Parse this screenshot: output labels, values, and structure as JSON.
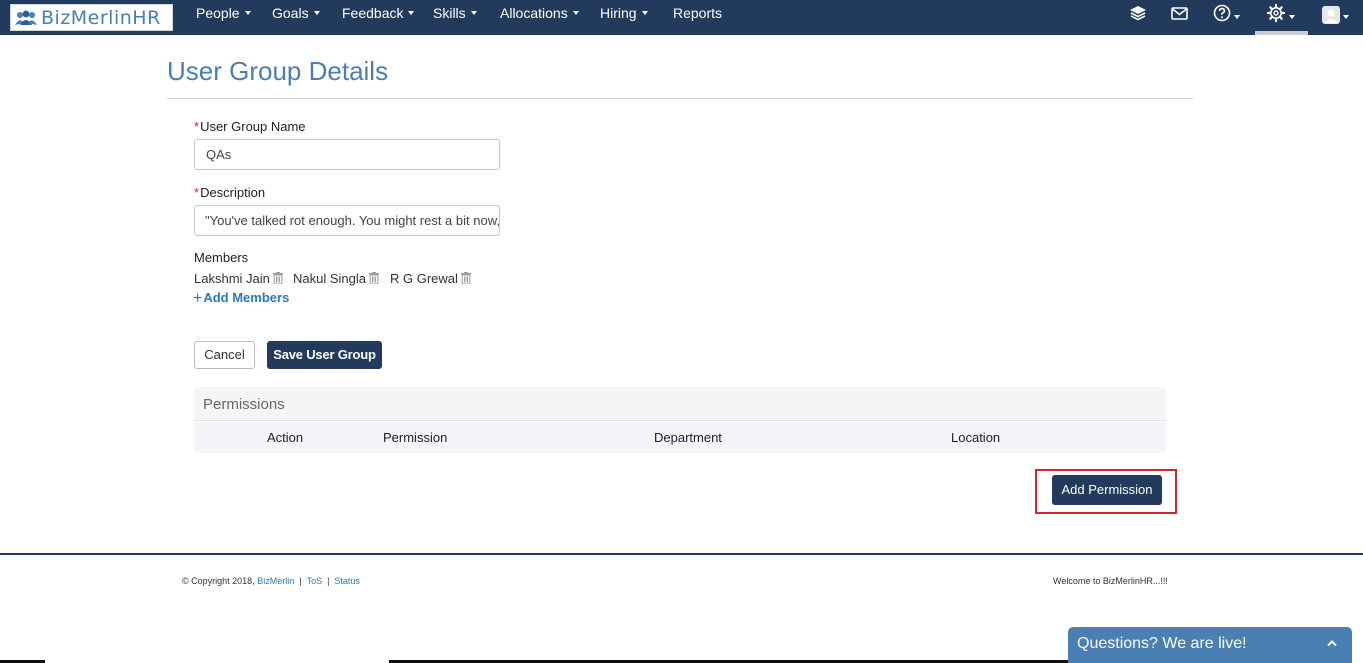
{
  "nav": {
    "brand": "BizMerlinHR",
    "items": [
      {
        "label": "People",
        "dropdown": true
      },
      {
        "label": "Goals",
        "dropdown": true
      },
      {
        "label": "Feedback",
        "dropdown": true
      },
      {
        "label": "Skills",
        "dropdown": true
      },
      {
        "label": "Allocations",
        "dropdown": true
      },
      {
        "label": "Hiring",
        "dropdown": true
      },
      {
        "label": "Reports",
        "dropdown": false
      }
    ],
    "icons": [
      "layers-icon",
      "mail-icon",
      "help-icon",
      "gear-icon",
      "avatar-icon"
    ]
  },
  "page": {
    "title": "User Group Details"
  },
  "form": {
    "name": {
      "label": "User Group Name",
      "value": "QAs"
    },
    "description": {
      "label": "Description",
      "value": "\"You've talked rot enough. You might rest a bit now,\""
    },
    "members": {
      "label": "Members",
      "items": [
        "Lakshmi Jain",
        "Nakul Singla",
        "R G Grewal"
      ],
      "add_label": "Add Members"
    },
    "cancel_label": "Cancel",
    "save_label": "Save User Group"
  },
  "permissions": {
    "title": "Permissions",
    "columns": [
      "Action",
      "Permission",
      "Department",
      "Location"
    ],
    "add_label": "Add Permission"
  },
  "footer": {
    "copyright": "© Copyright 2018,",
    "links": [
      "BizMerlin",
      "ToS",
      "Status"
    ],
    "welcome": "Welcome to BizMerlinHR...!!!"
  },
  "chat": {
    "label": "Questions? We are live!"
  },
  "colors": {
    "navbar": "#223b5c",
    "accent": "#4a7fb3",
    "link": "#2e78b8",
    "highlight": "#d0262d"
  }
}
